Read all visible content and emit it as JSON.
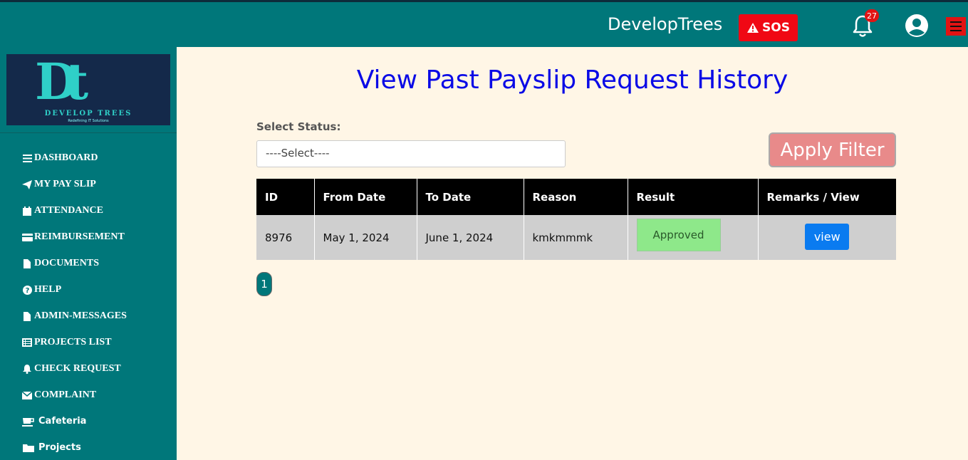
{
  "header": {
    "brand": "DevelopTrees",
    "sos_label": "SOS",
    "notification_count": "27",
    "icons": [
      "alert-triangle-icon",
      "bell-icon",
      "user-circle-icon",
      "hamburger-icon"
    ]
  },
  "sidebar": {
    "logo": {
      "letters": "Dt",
      "name": "DEVELOP TREES",
      "tagline": "Redefining IT Solutions"
    },
    "items": [
      {
        "label": "DASHBOARD",
        "icon": "list-icon"
      },
      {
        "label": "MY PAY SLIP",
        "icon": "paper-plane-icon"
      },
      {
        "label": "ATTENDANCE",
        "icon": "calendar-icon"
      },
      {
        "label": "REIMBURSEMENT",
        "icon": "credit-card-icon"
      },
      {
        "label": "DOCUMENTS",
        "icon": "file-icon"
      },
      {
        "label": "HELP",
        "icon": "question-circle-icon"
      },
      {
        "label": "ADMIN-MESSAGES",
        "icon": "file-icon"
      },
      {
        "label": "PROJECTS LIST",
        "icon": "list-alt-icon"
      },
      {
        "label": "CHECK REQUEST",
        "icon": "bell-icon"
      },
      {
        "label": "COMPLAINT",
        "icon": "envelope-icon"
      },
      {
        "label": "Cafeteria",
        "icon": "coffee-icon"
      },
      {
        "label": "Projects",
        "icon": "folder-icon"
      }
    ]
  },
  "main": {
    "title": "View Past Payslip Request History",
    "filter": {
      "label": "Select Status:",
      "selected": "----Select----",
      "apply_label": "Apply Filter"
    },
    "table": {
      "headers": [
        "ID",
        "From Date",
        "To Date",
        "Reason",
        "Result",
        "Remarks / View"
      ],
      "rows": [
        {
          "id": "8976",
          "from": "May 1, 2024",
          "to": "June 1, 2024",
          "reason": "kmkmmmk",
          "result": "Approved",
          "action": "view"
        }
      ]
    },
    "pagination": {
      "current": "1"
    }
  },
  "colors": {
    "teal": "#00777a",
    "sos_red": "#f00814",
    "title_blue": "#0a0ae6",
    "approved_green": "#8ee88a",
    "view_blue": "#0a7bf0",
    "apply_pink": "#e88a8a",
    "page_bg": "#fff6e6"
  }
}
